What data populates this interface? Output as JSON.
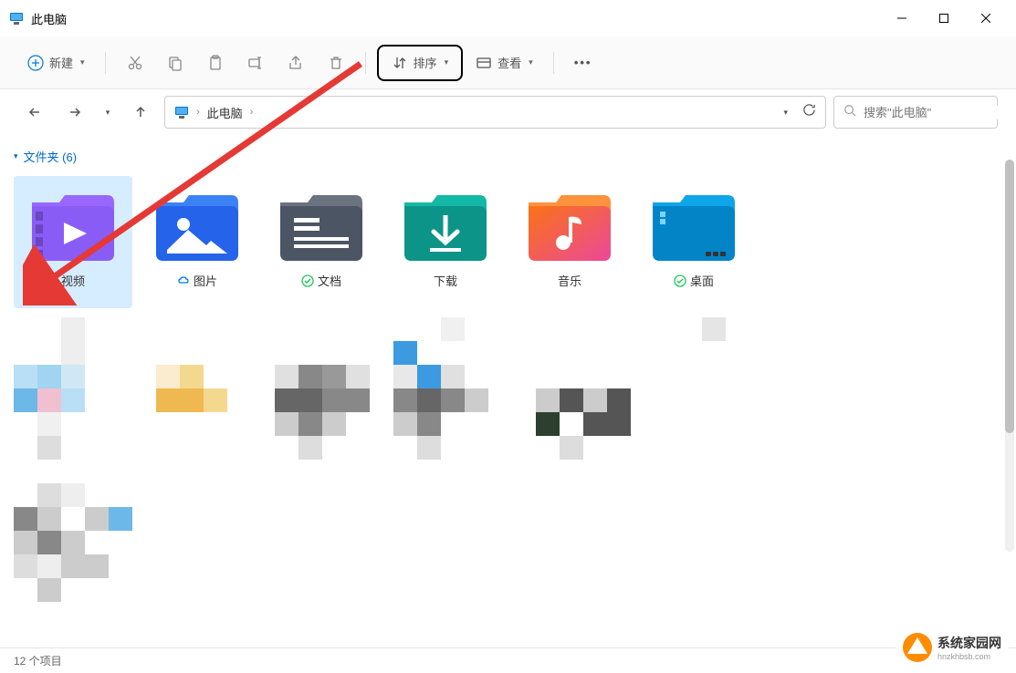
{
  "window": {
    "title": "此电脑"
  },
  "toolbar": {
    "new_label": "新建",
    "sort_label": "排序",
    "view_label": "查看"
  },
  "nav": {
    "breadcrumb": "此电脑"
  },
  "search": {
    "placeholder": "搜索\"此电脑\""
  },
  "section": {
    "folders_label": "文件夹 (6)"
  },
  "folders": [
    {
      "label": "视频",
      "sync": null
    },
    {
      "label": "图片",
      "sync": "cloud"
    },
    {
      "label": "文档",
      "sync": "check"
    },
    {
      "label": "下载",
      "sync": null
    },
    {
      "label": "音乐",
      "sync": null
    },
    {
      "label": "桌面",
      "sync": "check"
    }
  ],
  "status": {
    "items_text": "12 个项目"
  },
  "watermark": {
    "title": "系统家园网",
    "url": "hnzkhbsb.com"
  }
}
